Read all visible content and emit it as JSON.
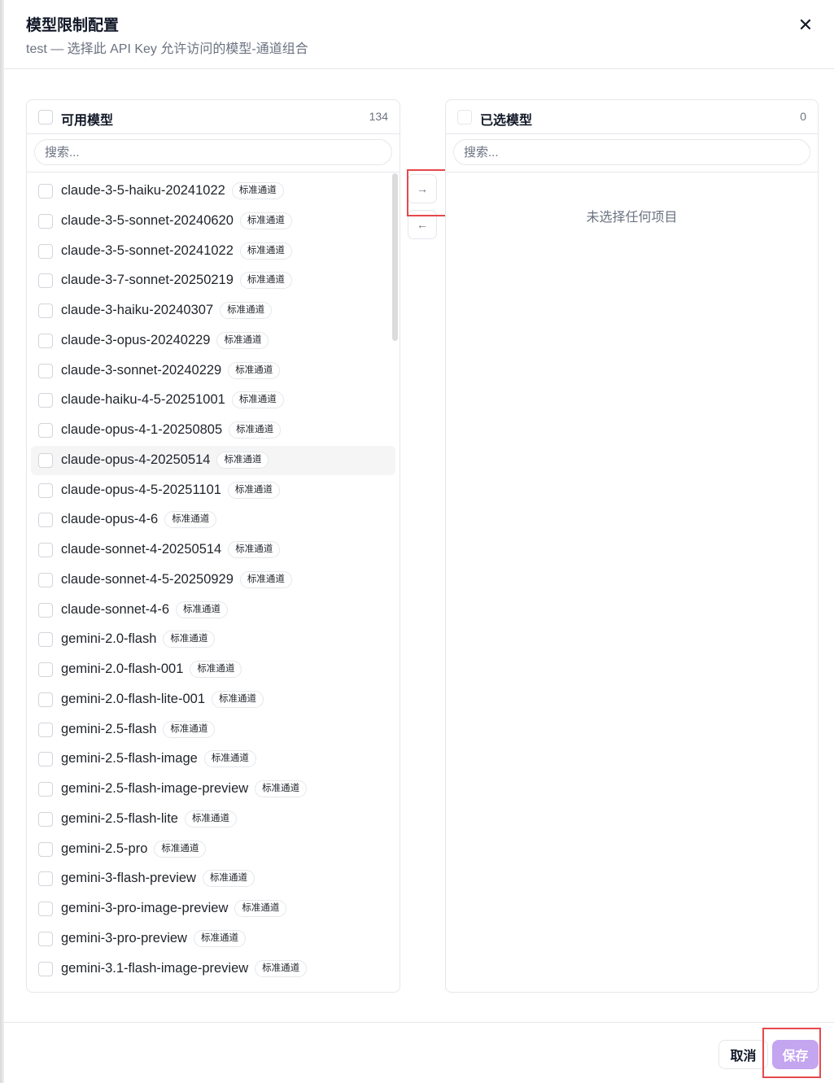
{
  "dialog": {
    "title": "模型限制配置",
    "subtitle": "test — 选择此 API Key 允许访问的模型-通道组合",
    "close_icon": "✕"
  },
  "available": {
    "title": "可用模型",
    "count": "134",
    "search_placeholder": "搜索...",
    "items": [
      {
        "name": "claude-3-5-haiku-20241022",
        "badge": "标准通道"
      },
      {
        "name": "claude-3-5-sonnet-20240620",
        "badge": "标准通道"
      },
      {
        "name": "claude-3-5-sonnet-20241022",
        "badge": "标准通道"
      },
      {
        "name": "claude-3-7-sonnet-20250219",
        "badge": "标准通道"
      },
      {
        "name": "claude-3-haiku-20240307",
        "badge": "标准通道"
      },
      {
        "name": "claude-3-opus-20240229",
        "badge": "标准通道"
      },
      {
        "name": "claude-3-sonnet-20240229",
        "badge": "标准通道"
      },
      {
        "name": "claude-haiku-4-5-20251001",
        "badge": "标准通道"
      },
      {
        "name": "claude-opus-4-1-20250805",
        "badge": "标准通道"
      },
      {
        "name": "claude-opus-4-20250514",
        "badge": "标准通道"
      },
      {
        "name": "claude-opus-4-5-20251101",
        "badge": "标准通道"
      },
      {
        "name": "claude-opus-4-6",
        "badge": "标准通道"
      },
      {
        "name": "claude-sonnet-4-20250514",
        "badge": "标准通道"
      },
      {
        "name": "claude-sonnet-4-5-20250929",
        "badge": "标准通道"
      },
      {
        "name": "claude-sonnet-4-6",
        "badge": "标准通道"
      },
      {
        "name": "gemini-2.0-flash",
        "badge": "标准通道"
      },
      {
        "name": "gemini-2.0-flash-001",
        "badge": "标准通道"
      },
      {
        "name": "gemini-2.0-flash-lite-001",
        "badge": "标准通道"
      },
      {
        "name": "gemini-2.5-flash",
        "badge": "标准通道"
      },
      {
        "name": "gemini-2.5-flash-image",
        "badge": "标准通道"
      },
      {
        "name": "gemini-2.5-flash-image-preview",
        "badge": "标准通道"
      },
      {
        "name": "gemini-2.5-flash-lite",
        "badge": "标准通道"
      },
      {
        "name": "gemini-2.5-pro",
        "badge": "标准通道"
      },
      {
        "name": "gemini-3-flash-preview",
        "badge": "标准通道"
      },
      {
        "name": "gemini-3-pro-image-preview",
        "badge": "标准通道"
      },
      {
        "name": "gemini-3-pro-preview",
        "badge": "标准通道"
      },
      {
        "name": "gemini-3.1-flash-image-preview",
        "badge": "标准通道"
      }
    ]
  },
  "selected": {
    "title": "已选模型",
    "count": "0",
    "search_placeholder": "搜索...",
    "empty_text": "未选择任何项目"
  },
  "transfer": {
    "move_right_icon": "→",
    "move_left_icon": "←"
  },
  "footer": {
    "cancel_label": "取消",
    "save_label": "保存"
  },
  "colors": {
    "accent": "#c4a5f0",
    "highlight": "#e5484d"
  }
}
